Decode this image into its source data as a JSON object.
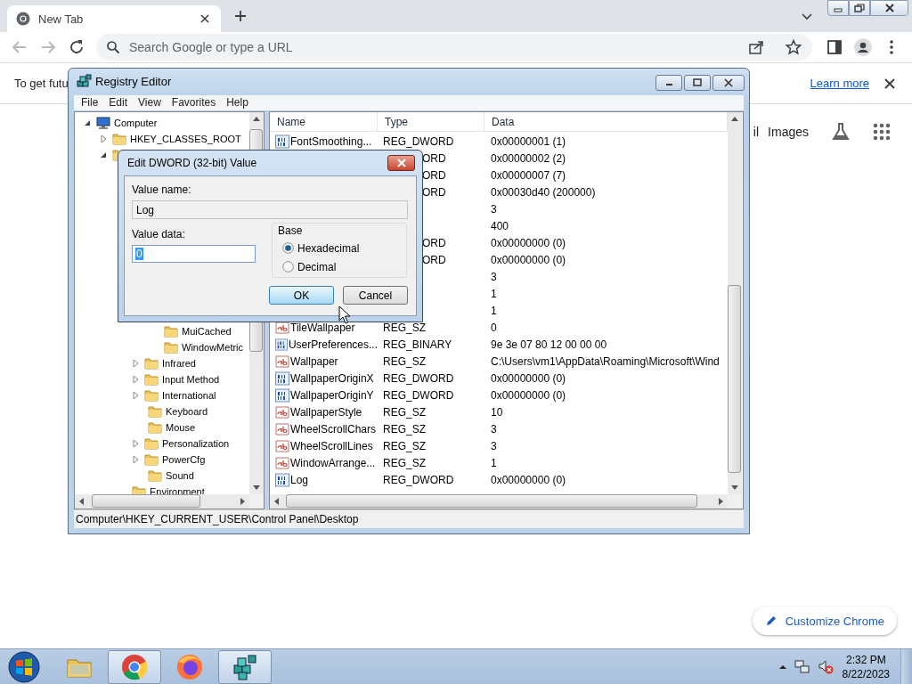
{
  "browser": {
    "tab": {
      "title": "New Tab"
    },
    "omnibox": {
      "placeholder": "Search Google or type a URL"
    },
    "banner": {
      "text": "To get futu",
      "link": "Learn more"
    },
    "header_links": [
      "il",
      "Images"
    ],
    "customize_button": "Customize Chrome"
  },
  "registry_editor": {
    "title": "Registry Editor",
    "menu": [
      "File",
      "Edit",
      "View",
      "Favorites",
      "Help"
    ],
    "tree": [
      {
        "label": "Computer",
        "kind": "computer",
        "expanded": true,
        "children": [
          {
            "label": "HKEY_CLASSES_ROOT",
            "expanded": false
          },
          {
            "expanded": true,
            "children": [
              {
                "expanded": true,
                "children": [
                  {
                    "expanded": true,
                    "children": [
                      {
                        "label": "MuiCached"
                      },
                      {
                        "label": "WindowMetric"
                      }
                    ]
                  },
                  {
                    "label": "Infrared",
                    "expanded": false
                  },
                  {
                    "label": "Input Method",
                    "expanded": false
                  },
                  {
                    "label": "International",
                    "expanded": false
                  },
                  {
                    "label": "Keyboard"
                  },
                  {
                    "label": "Mouse"
                  },
                  {
                    "label": "Personalization",
                    "expanded": false
                  },
                  {
                    "label": "PowerCfg",
                    "expanded": false
                  },
                  {
                    "label": "Sound"
                  }
                ]
              },
              {
                "label": "Environment"
              }
            ]
          }
        ]
      }
    ],
    "columns": [
      "Name",
      "Type",
      "Data"
    ],
    "rows": [
      {
        "kind": "dword",
        "name": "FontSmoothing...",
        "type": "REG_DWORD",
        "data": "0x00000001 (1)"
      },
      {
        "type": "ORD",
        "data": "0x00000002 (2)"
      },
      {
        "type": "ORD",
        "data": "0x00000007 (7)"
      },
      {
        "type": "ORD",
        "data": "0x00030d40 (200000)"
      },
      {
        "data": "3"
      },
      {
        "data": "400"
      },
      {
        "type": "ORD",
        "data": "0x00000000 (0)"
      },
      {
        "type": "ORD",
        "data": "0x00000000 (0)"
      },
      {
        "data": "3"
      },
      {
        "data": "1"
      },
      {
        "data": "1"
      },
      {
        "kind": "string",
        "name": "TileWallpaper",
        "type": "REG_SZ",
        "data": "0"
      },
      {
        "kind": "binary",
        "name": "UserPreferences...",
        "type": "REG_BINARY",
        "data": "9e 3e 07 80 12 00 00 00"
      },
      {
        "kind": "string",
        "name": "Wallpaper",
        "type": "REG_SZ",
        "data": "C:\\Users\\vm1\\AppData\\Roaming\\Microsoft\\Wind"
      },
      {
        "kind": "dword",
        "name": "WallpaperOriginX",
        "type": "REG_DWORD",
        "data": "0x00000000 (0)"
      },
      {
        "kind": "dword",
        "name": "WallpaperOriginY",
        "type": "REG_DWORD",
        "data": "0x00000000 (0)"
      },
      {
        "kind": "string",
        "name": "WallpaperStyle",
        "type": "REG_SZ",
        "data": "10"
      },
      {
        "kind": "string",
        "name": "WheelScrollChars",
        "type": "REG_SZ",
        "data": "3"
      },
      {
        "kind": "string",
        "name": "WheelScrollLines",
        "type": "REG_SZ",
        "data": "3"
      },
      {
        "kind": "string",
        "name": "WindowArrange...",
        "type": "REG_SZ",
        "data": "1"
      },
      {
        "kind": "dword",
        "name": "Log",
        "type": "REG_DWORD",
        "data": "0x00000000 (0)"
      }
    ],
    "status_bar": "Computer\\HKEY_CURRENT_USER\\Control Panel\\Desktop"
  },
  "dialog": {
    "title": "Edit DWORD (32-bit) Value",
    "value_name_label": "Value name:",
    "value_name": "Log",
    "value_data_label": "Value data:",
    "value_data": "0",
    "value_data_selected": true,
    "base_label": "Base",
    "bases": [
      {
        "label": "Hexadecimal",
        "selected": true
      },
      {
        "label": "Decimal",
        "selected": false
      }
    ],
    "buttons": [
      {
        "label": "OK",
        "default": true
      },
      {
        "label": "Cancel",
        "default": false
      }
    ]
  },
  "taskbar": {
    "apps": [
      {
        "kind": "explorer",
        "active": false
      },
      {
        "kind": "chrome",
        "active": true
      },
      {
        "kind": "firefox",
        "active": false
      },
      {
        "kind": "regedit",
        "active": true
      }
    ],
    "time": "2:32 PM",
    "date": "8/22/2023"
  }
}
